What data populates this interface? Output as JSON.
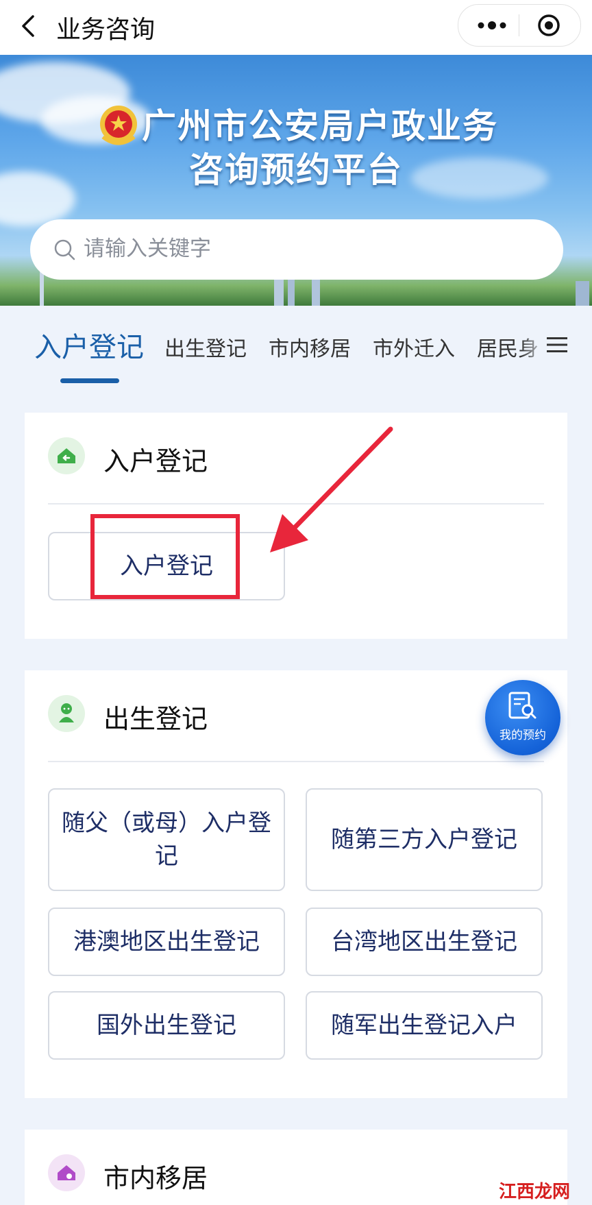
{
  "header": {
    "title": "业务咨询"
  },
  "banner": {
    "title_line1": "广州市公安局户政业务",
    "title_line2": "咨询预约平台",
    "search_placeholder": "请输入关键字"
  },
  "tabs": [
    {
      "label": "入户登记",
      "active": true
    },
    {
      "label": "出生登记",
      "active": false
    },
    {
      "label": "市内移居",
      "active": false
    },
    {
      "label": "市外迁入",
      "active": false
    },
    {
      "label": "居民身",
      "active": false
    }
  ],
  "sections": [
    {
      "title": "入户登记",
      "icon": "home-arrow-icon",
      "options": [
        "入户登记"
      ]
    },
    {
      "title": "出生登记",
      "icon": "baby-icon",
      "options": [
        "随父（或母）入户登记",
        "随第三方入户登记",
        "港澳地区出生登记",
        "台湾地区出生登记",
        "国外出生登记",
        "随军出生登记入户"
      ]
    },
    {
      "title": "市内移居",
      "icon": "home-move-icon",
      "options": []
    }
  ],
  "fab": {
    "label": "我的预约"
  },
  "watermark": "江西龙网",
  "colors": {
    "accent": "#1a5fa8",
    "option_text": "#1e2e66",
    "highlight": "#e8263b",
    "fab": "#1462d8"
  }
}
